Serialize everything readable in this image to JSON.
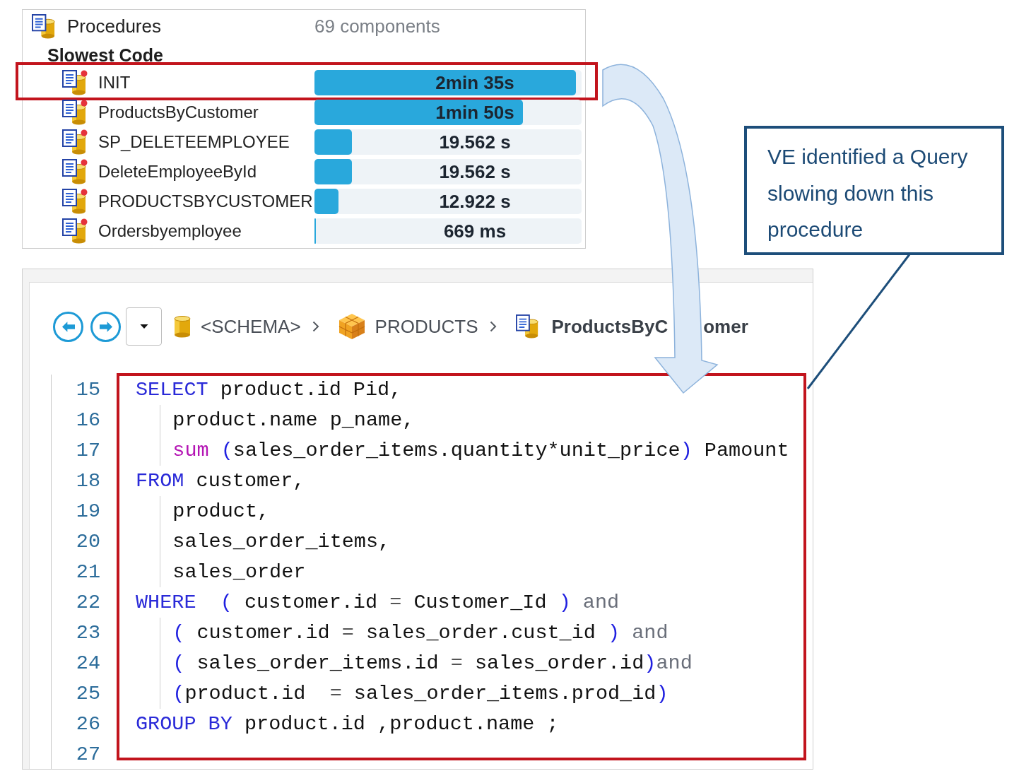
{
  "procedures_panel": {
    "title": "Procedures",
    "count": "69 components",
    "section": "Slowest Code",
    "rows": [
      {
        "name": "INIT",
        "duration": "2min 35s",
        "level": 0.98,
        "highlighted": true
      },
      {
        "name": "ProductsByCustomer",
        "duration": "1min 50s",
        "level": 0.78,
        "highlighted": false
      },
      {
        "name": "SP_DELETEEMPLOYEE",
        "duration": "19.562 s",
        "level": 0.14,
        "highlighted": false
      },
      {
        "name": "DeleteEmployeeById",
        "duration": "19.562 s",
        "level": 0.14,
        "highlighted": false
      },
      {
        "name": "PRODUCTSBYCUSTOMER",
        "duration": "12.922 s",
        "level": 0.09,
        "highlighted": false
      },
      {
        "name": "Ordersbyemployee",
        "duration": "669 ms",
        "level": 0.006,
        "highlighted": false
      }
    ]
  },
  "editor": {
    "breadcrumb": [
      {
        "kind": "schema",
        "label_parts": [
          "<SCHEMA>"
        ],
        "current": false
      },
      {
        "kind": "package",
        "label_parts": [
          "PRODUCTS"
        ],
        "current": false
      },
      {
        "kind": "procedure",
        "label_parts": [
          "ProductsByC",
          "omer"
        ],
        "current": true
      }
    ],
    "lines": [
      {
        "number": "15",
        "indented": false,
        "tokens": [
          {
            "kind": "keyword",
            "text": "SELECT"
          },
          {
            "kind": "plain",
            "text": " product.id Pid,"
          }
        ]
      },
      {
        "number": "16",
        "indented": true,
        "tokens": [
          {
            "kind": "plain",
            "text": "product.name p_name,"
          }
        ]
      },
      {
        "number": "17",
        "indented": true,
        "tokens": [
          {
            "kind": "function",
            "text": "sum"
          },
          {
            "kind": "paren",
            "text": " ("
          },
          {
            "kind": "plain",
            "text": "sales_order_items.quantity*unit_price"
          },
          {
            "kind": "paren",
            "text": ")"
          },
          {
            "kind": "plain",
            "text": " Pamount"
          }
        ]
      },
      {
        "number": "18",
        "indented": false,
        "tokens": [
          {
            "kind": "keyword",
            "text": "FROM"
          },
          {
            "kind": "plain",
            "text": " customer,"
          }
        ]
      },
      {
        "number": "19",
        "indented": true,
        "tokens": [
          {
            "kind": "plain",
            "text": "product,"
          }
        ]
      },
      {
        "number": "20",
        "indented": true,
        "tokens": [
          {
            "kind": "plain",
            "text": "sales_order_items,"
          }
        ]
      },
      {
        "number": "21",
        "indented": true,
        "tokens": [
          {
            "kind": "plain",
            "text": "sales_order"
          }
        ]
      },
      {
        "number": "22",
        "indented": false,
        "tokens": [
          {
            "kind": "keyword",
            "text": "WHERE"
          },
          {
            "kind": "paren",
            "text": "  ("
          },
          {
            "kind": "plain",
            "text": " customer.id "
          },
          {
            "kind": "operator",
            "text": "="
          },
          {
            "kind": "plain",
            "text": " Customer_Id "
          },
          {
            "kind": "paren",
            "text": ")"
          },
          {
            "kind": "logic",
            "text": " and"
          }
        ]
      },
      {
        "number": "23",
        "indented": true,
        "tokens": [
          {
            "kind": "paren",
            "text": "("
          },
          {
            "kind": "plain",
            "text": " customer.id "
          },
          {
            "kind": "operator",
            "text": "="
          },
          {
            "kind": "plain",
            "text": " sales_order.cust_id "
          },
          {
            "kind": "paren",
            "text": ")"
          },
          {
            "kind": "logic",
            "text": " and"
          }
        ]
      },
      {
        "number": "24",
        "indented": true,
        "tokens": [
          {
            "kind": "paren",
            "text": "("
          },
          {
            "kind": "plain",
            "text": " sales_order_items.id "
          },
          {
            "kind": "operator",
            "text": "="
          },
          {
            "kind": "plain",
            "text": " sales_order.id"
          },
          {
            "kind": "paren",
            "text": ")"
          },
          {
            "kind": "logic",
            "text": "and"
          }
        ]
      },
      {
        "number": "25",
        "indented": true,
        "tokens": [
          {
            "kind": "paren",
            "text": "("
          },
          {
            "kind": "plain",
            "text": "product.id  "
          },
          {
            "kind": "operator",
            "text": "="
          },
          {
            "kind": "plain",
            "text": " sales_order_items.prod_id"
          },
          {
            "kind": "paren",
            "text": ")"
          }
        ]
      },
      {
        "number": "26",
        "indented": false,
        "tokens": [
          {
            "kind": "keyword",
            "text": "GROUP"
          },
          {
            "kind": "keyword",
            "text": " BY"
          },
          {
            "kind": "plain",
            "text": " product.id ,product.name ;"
          }
        ]
      },
      {
        "number": "27",
        "indented": false
      }
    ]
  },
  "callout": {
    "text": "VE identified a Query slowing down this procedure"
  }
}
